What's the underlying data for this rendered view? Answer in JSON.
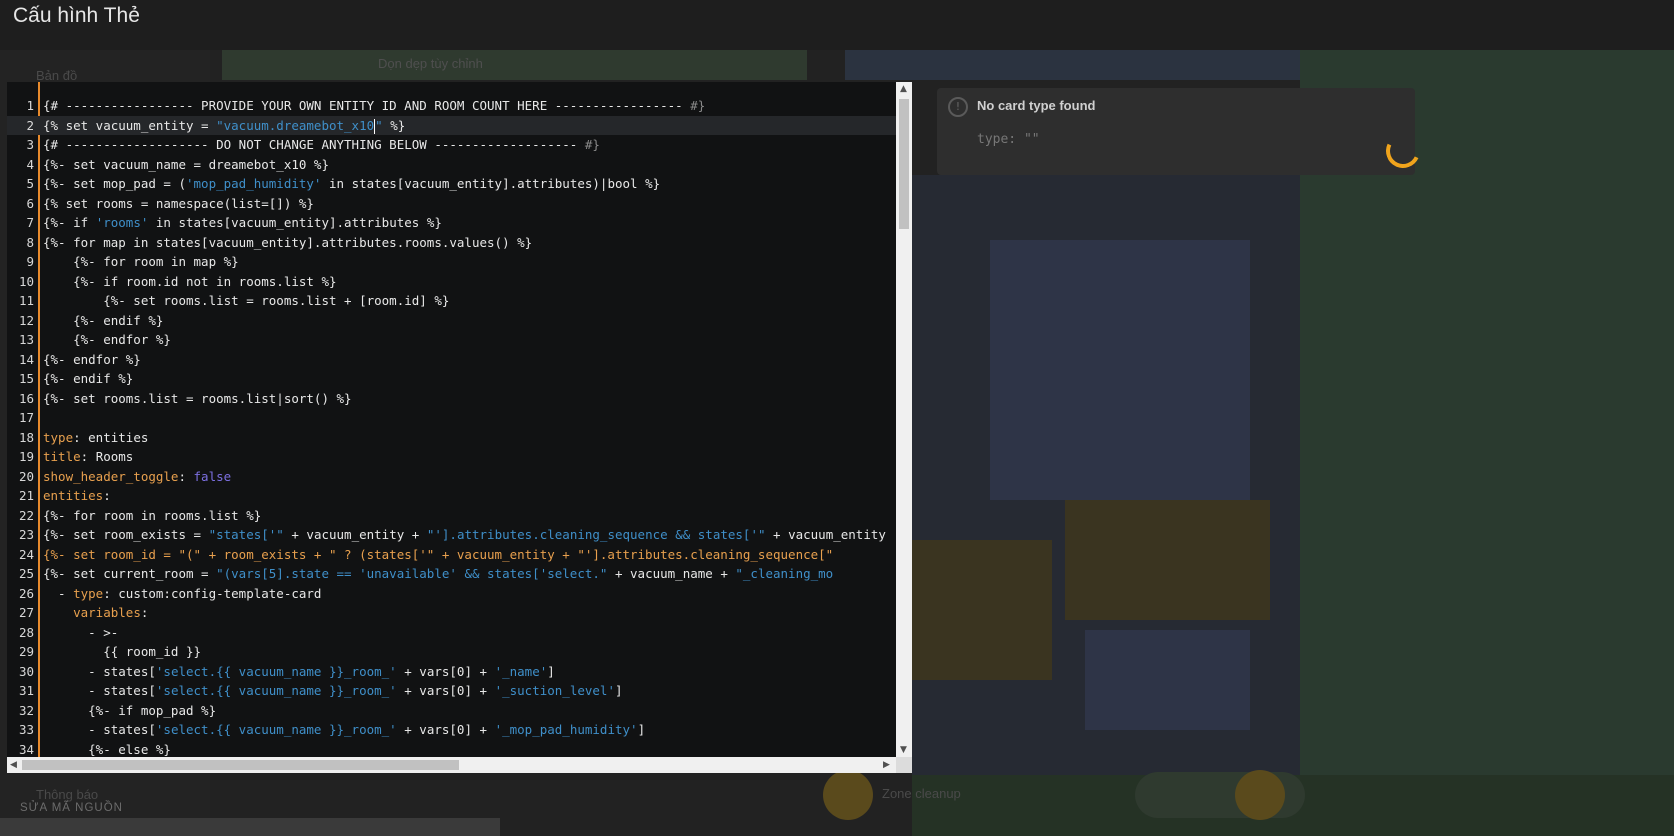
{
  "dialog": {
    "title": "Cấu hình Thẻ",
    "source_edit_label": "SỬA MÃ NGUỒN"
  },
  "editor": {
    "active_line": 2,
    "lines": [
      {
        "n": "1",
        "tokens": [
          {
            "t": "{# ----------------- PROVIDE YOUR OWN ENTITY ID AND ROOM COUNT HERE ----------------- "
          },
          {
            "t": "#}",
            "c": "c"
          }
        ]
      },
      {
        "n": "2",
        "tokens": [
          {
            "t": "{% set vacuum_entity = "
          },
          {
            "t": "\"vacuum.dreamebot_x10",
            "c": "s"
          },
          {
            "cursor": true
          },
          {
            "t": "\"",
            "c": "s"
          },
          {
            "t": " %}"
          }
        ]
      },
      {
        "n": "3",
        "tokens": [
          {
            "t": "{# ------------------- DO NOT CHANGE ANYTHING BELOW ------------------- "
          },
          {
            "t": "#}",
            "c": "c"
          }
        ]
      },
      {
        "n": "4",
        "tokens": [
          {
            "t": "{%- set vacuum_name = dreamebot_x10 %}"
          }
        ]
      },
      {
        "n": "5",
        "tokens": [
          {
            "t": "{%- set mop_pad = ("
          },
          {
            "t": "'mop_pad_humidity'",
            "c": "s"
          },
          {
            "t": " in states[vacuum_entity].attributes)|bool %}"
          }
        ]
      },
      {
        "n": "6",
        "tokens": [
          {
            "t": "{% set rooms = namespace(list=[]) %}"
          }
        ]
      },
      {
        "n": "7",
        "tokens": [
          {
            "t": "{%- if "
          },
          {
            "t": "'rooms'",
            "c": "s"
          },
          {
            "t": " in states[vacuum_entity].attributes %}"
          }
        ]
      },
      {
        "n": "8",
        "tokens": [
          {
            "t": "{%- for map in states[vacuum_entity].attributes.rooms.values() %}"
          }
        ]
      },
      {
        "n": "9",
        "tokens": [
          {
            "t": "    {%- for room in map %}"
          }
        ]
      },
      {
        "n": "10",
        "tokens": [
          {
            "t": "    {%- if room.id not in rooms.list %}"
          }
        ]
      },
      {
        "n": "11",
        "tokens": [
          {
            "t": "        {%- set rooms.list = rooms.list + [room.id] %}"
          }
        ]
      },
      {
        "n": "12",
        "tokens": [
          {
            "t": "    {%- endif %}"
          }
        ]
      },
      {
        "n": "13",
        "tokens": [
          {
            "t": "    {%- endfor %}"
          }
        ]
      },
      {
        "n": "14",
        "tokens": [
          {
            "t": "{%- endfor %}"
          }
        ]
      },
      {
        "n": "15",
        "tokens": [
          {
            "t": "{%- endif %}"
          }
        ]
      },
      {
        "n": "16",
        "tokens": [
          {
            "t": "{%- set rooms.list = rooms.list|sort() %}"
          }
        ]
      },
      {
        "n": "17",
        "tokens": []
      },
      {
        "n": "18",
        "tokens": [
          {
            "t": "type",
            "c": "k"
          },
          {
            "t": ": entities"
          }
        ]
      },
      {
        "n": "19",
        "tokens": [
          {
            "t": "title",
            "c": "k"
          },
          {
            "t": ": Rooms"
          }
        ]
      },
      {
        "n": "20",
        "tokens": [
          {
            "t": "show_header_toggle",
            "c": "k"
          },
          {
            "t": ": "
          },
          {
            "t": "false",
            "c": "b"
          }
        ]
      },
      {
        "n": "21",
        "tokens": [
          {
            "t": "entities",
            "c": "k"
          },
          {
            "t": ":"
          }
        ]
      },
      {
        "n": "22",
        "tokens": [
          {
            "t": "{%- for room in rooms.list %}"
          }
        ]
      },
      {
        "n": "23",
        "tokens": [
          {
            "t": "{%- set room_exists = "
          },
          {
            "t": "\"states['\"",
            "c": "s"
          },
          {
            "t": " + vacuum_entity + "
          },
          {
            "t": "\"'].attributes.cleaning_sequence && states['\"",
            "c": "s"
          },
          {
            "t": " + vacuum_entity"
          }
        ]
      },
      {
        "n": "24",
        "tokens": [
          {
            "t": "{%- set room_id = \"(\" + room_exists + \" ? (states['\" + vacuum_entity + \"'].attributes.cleaning_sequence[\"",
            "c": "k"
          }
        ]
      },
      {
        "n": "25",
        "tokens": [
          {
            "t": "{%- set current_room = "
          },
          {
            "t": "\"(vars[5].state == 'unavailable' && states['select.\"",
            "c": "s"
          },
          {
            "t": " + vacuum_name + "
          },
          {
            "t": "\"_cleaning_mo",
            "c": "s"
          }
        ]
      },
      {
        "n": "26",
        "tokens": [
          {
            "t": "  - "
          },
          {
            "t": "type",
            "c": "k"
          },
          {
            "t": ": custom:config-template-card"
          }
        ]
      },
      {
        "n": "27",
        "tokens": [
          {
            "t": "    "
          },
          {
            "t": "variables",
            "c": "k"
          },
          {
            "t": ":"
          }
        ]
      },
      {
        "n": "28",
        "tokens": [
          {
            "t": "      - >-"
          }
        ]
      },
      {
        "n": "29",
        "tokens": [
          {
            "t": "        {{ room_id }}"
          }
        ]
      },
      {
        "n": "30",
        "tokens": [
          {
            "t": "      - states["
          },
          {
            "t": "'select.{{ vacuum_name }}_room_'",
            "c": "s"
          },
          {
            "t": " + vars[0] + "
          },
          {
            "t": "'_name'",
            "c": "s"
          },
          {
            "t": "]"
          }
        ]
      },
      {
        "n": "31",
        "tokens": [
          {
            "t": "      - states["
          },
          {
            "t": "'select.{{ vacuum_name }}_room_'",
            "c": "s"
          },
          {
            "t": " + vars[0] + "
          },
          {
            "t": "'_suction_level'",
            "c": "s"
          },
          {
            "t": "]"
          }
        ]
      },
      {
        "n": "32",
        "tokens": [
          {
            "t": "      {%- if mop_pad %}"
          }
        ]
      },
      {
        "n": "33",
        "tokens": [
          {
            "t": "      - states["
          },
          {
            "t": "'select.{{ vacuum_name }}_room_'",
            "c": "s"
          },
          {
            "t": " + vars[0] + "
          },
          {
            "t": "'_mop_pad_humidity'",
            "c": "s"
          },
          {
            "t": "]"
          }
        ]
      },
      {
        "n": "34",
        "tokens": [
          {
            "t": "      {%- else %}"
          }
        ]
      }
    ]
  },
  "preview": {
    "error_title": "No card type found",
    "error_code": "type: \"\""
  },
  "background": {
    "map_label": "Bản đồ",
    "custom_clean_label": "Dọn dẹp tùy chỉnh",
    "notify_label": "Thông báo",
    "zone_cleanup_label": "Zone cleanup"
  },
  "colors": {
    "accent_orange": "#e88a2c",
    "spinner": "#f0a41c",
    "string": "#3f8fc9",
    "keyword": "#e8a04e",
    "boolean": "#7c6fe0"
  }
}
